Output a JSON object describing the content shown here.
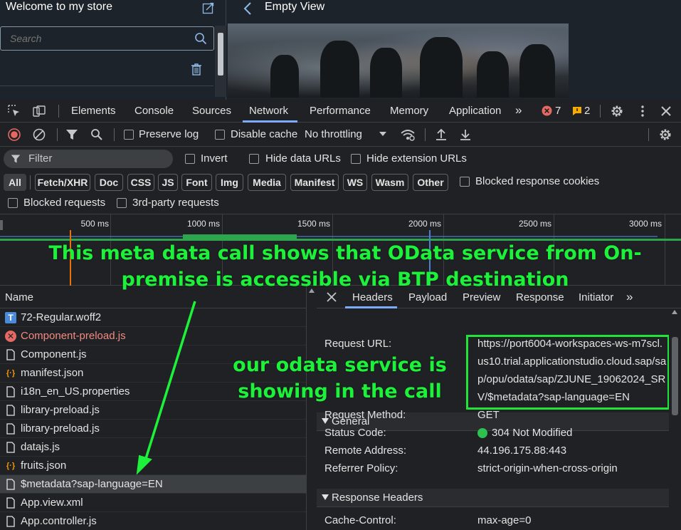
{
  "app": {
    "left_title": "Welcome to my store",
    "search_placeholder": "Search",
    "right_title": "Empty View"
  },
  "devtools": {
    "tabs": [
      "Elements",
      "Console",
      "Sources",
      "Network",
      "Performance",
      "Memory",
      "Application"
    ],
    "active_tab": "Network",
    "error_count": "7",
    "warning_count": "2",
    "toolbar": {
      "preserve_log": "Preserve log",
      "disable_cache": "Disable cache",
      "throttling": "No throttling"
    },
    "filter": {
      "placeholder": "Filter",
      "invert": "Invert",
      "hide_data_urls": "Hide data URLs",
      "hide_extension_urls": "Hide extension URLs"
    },
    "type_chips": [
      "All",
      "Fetch/XHR",
      "Doc",
      "CSS",
      "JS",
      "Font",
      "Img",
      "Media",
      "Manifest",
      "WS",
      "Wasm",
      "Other"
    ],
    "blocked_response_cookies": "Blocked response cookies",
    "blocked_requests": "Blocked requests",
    "third_party_requests": "3rd-party requests",
    "timeline_ticks": [
      "500 ms",
      "1000 ms",
      "1500 ms",
      "2000 ms",
      "2500 ms",
      "3000 ms"
    ],
    "list_header": "Name",
    "requests": [
      {
        "name": "72-Regular.woff2",
        "icon": "font-icon",
        "status": "ok"
      },
      {
        "name": "Component-preload.js",
        "icon": "error-icon",
        "status": "error"
      },
      {
        "name": "Component.js",
        "icon": "file-icon",
        "status": "ok"
      },
      {
        "name": "manifest.json",
        "icon": "json-icon",
        "status": "ok"
      },
      {
        "name": "i18n_en_US.properties",
        "icon": "file-icon",
        "status": "ok"
      },
      {
        "name": "library-preload.js",
        "icon": "file-icon",
        "status": "ok"
      },
      {
        "name": "library-preload.js",
        "icon": "file-icon",
        "status": "ok"
      },
      {
        "name": "datajs.js",
        "icon": "file-icon",
        "status": "ok"
      },
      {
        "name": "fruits.json",
        "icon": "json-icon",
        "status": "ok"
      },
      {
        "name": "$metadata?sap-language=EN",
        "icon": "file-icon",
        "status": "selected"
      },
      {
        "name": "App.view.xml",
        "icon": "file-icon",
        "status": "ok"
      },
      {
        "name": "App.controller.js",
        "icon": "file-icon",
        "status": "ok"
      }
    ],
    "detail_tabs": [
      "Headers",
      "Payload",
      "Preview",
      "Response",
      "Initiator"
    ],
    "active_detail_tab": "Headers",
    "general": {
      "title": "General",
      "request_url_label": "Request URL:",
      "request_url_lines": [
        "https://port6004-workspaces-ws-m7scl.",
        "us10.trial.applicationstudio.cloud.sap/sa",
        "p/opu/odata/sap/ZJUNE_19062024_SR",
        "V/$metadata?sap-language=EN"
      ],
      "request_method_label": "Request Method:",
      "request_method": "GET",
      "status_code_label": "Status Code:",
      "status_code": "304 Not Modified",
      "remote_address_label": "Remote Address:",
      "remote_address": "44.196.175.88:443",
      "referrer_policy_label": "Referrer Policy:",
      "referrer_policy": "strict-origin-when-cross-origin"
    },
    "response_headers": {
      "title": "Response Headers",
      "cache_control_label": "Cache-Control:",
      "cache_control": "max-age=0"
    }
  },
  "annotations": {
    "top_note": "This meta data call shows that OData service from On-premise is accessible via BTP destination",
    "middle_note": "our odata service is showing in the call",
    "highlight_color": "#1df23a"
  }
}
